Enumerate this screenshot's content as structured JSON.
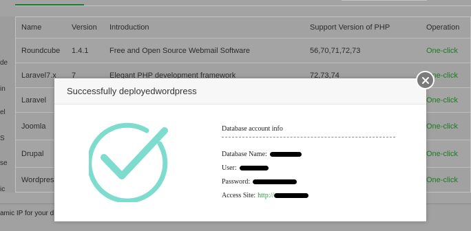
{
  "table": {
    "headers": {
      "name": "Name",
      "version": "Version",
      "introduction": "Introduction",
      "support": "Support Version of PHP",
      "operation": "Operation"
    },
    "rows": [
      {
        "name": "Roundcube",
        "version": "1.4.1",
        "introduction": "Free and Open Source Webmail Software",
        "support": "56,70,71,72,73",
        "operation": "One-click"
      },
      {
        "name": "Laravel7.x",
        "version": "7",
        "introduction": "Elegant PHP development framework",
        "support": "72,73,74",
        "operation": "One-click"
      },
      {
        "name": "Laravel",
        "version": "",
        "introduction": "",
        "support": "",
        "operation": "One-click"
      },
      {
        "name": "Joomla",
        "version": "",
        "introduction": "",
        "support": "",
        "operation": "One-click"
      },
      {
        "name": "Drupal",
        "version": "",
        "introduction": "",
        "support": "",
        "operation": "One-click"
      },
      {
        "name": "Wordpress",
        "version": "",
        "introduction": "",
        "support": "",
        "operation": "One-click"
      }
    ]
  },
  "left_fragments": [
    "de",
    "in",
    "el",
    "S",
    "se",
    "ic"
  ],
  "footer": {
    "text": "amic IP for your d"
  },
  "modal": {
    "title": "Successfully deployedwordpress",
    "info_heading": "Database account info",
    "db_name_label": "Database Name:",
    "user_label": "User:",
    "password_label": "Password:",
    "access_site_label": "Access Site:",
    "access_site_prefix": "http://"
  },
  "icons": {
    "close": "close-icon",
    "success": "checkmark-circle-icon"
  },
  "colors": {
    "success_teal": "#7ddccd",
    "link_green": "#2f9a43",
    "operation_green": "#1b7d22",
    "overlay_gray": "#a3a3a3"
  }
}
